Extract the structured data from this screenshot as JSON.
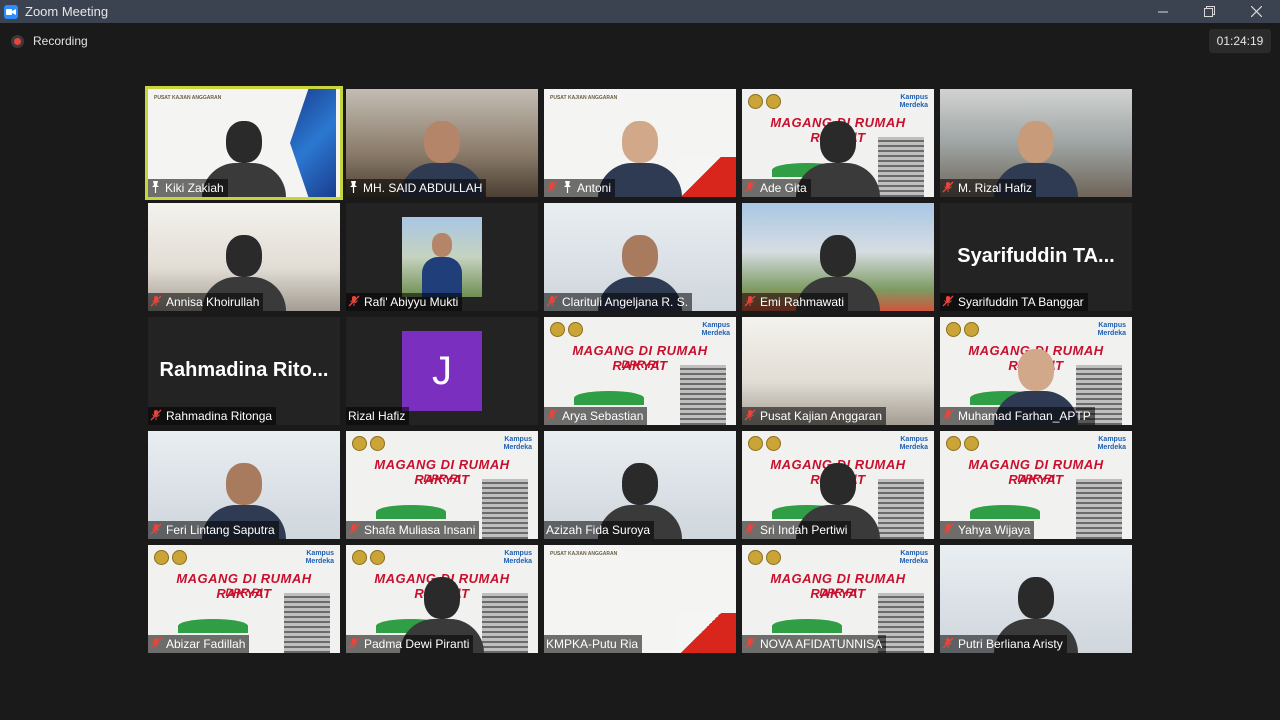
{
  "window": {
    "title": "Zoom Meeting"
  },
  "recording": {
    "label": "Recording"
  },
  "timer": {
    "value": "01:24:19"
  },
  "colors": {
    "active_speaker": "#c7d43a",
    "titlebar": "#3c4350",
    "mic_muted": "#e8453c"
  },
  "participants": [
    {
      "name": "Kiki Zakiah",
      "pinned": true,
      "muted": false,
      "video": "slide-chevron",
      "active": true
    },
    {
      "name": "MH. SAID ABDULLAH",
      "pinned": true,
      "muted": false,
      "video": "room"
    },
    {
      "name": "Antoni",
      "pinned": true,
      "muted": true,
      "video": "slide"
    },
    {
      "name": "Ade Gita",
      "muted": true,
      "video": "banner"
    },
    {
      "name": "M. Rizal Hafiz",
      "muted": true,
      "video": "library"
    },
    {
      "name": "Annisa Khoirullah",
      "muted": true,
      "video": "office"
    },
    {
      "name": "Rafi' Abiyyu Mukti",
      "muted": true,
      "video": "outdoor-small"
    },
    {
      "name": "Clarituli Angeljana R. S.",
      "muted": true,
      "video": "bright"
    },
    {
      "name": "Emi Rahmawati",
      "muted": true,
      "video": "outdoor"
    },
    {
      "name": "Syarifuddin TA Banggar",
      "muted": true,
      "video": "off",
      "display_name": "Syarifuddin TA..."
    },
    {
      "name": "Rahmadina Ritonga",
      "muted": true,
      "video": "off",
      "display_name": "Rahmadina Rito..."
    },
    {
      "name": "Rizal Hafiz",
      "muted": false,
      "video": "avatar",
      "avatar_letter": "J"
    },
    {
      "name": "Arya Sebastian",
      "muted": true,
      "video": "banner"
    },
    {
      "name": "Pusat Kajian Anggaran",
      "muted": true,
      "video": "office"
    },
    {
      "name": "Muhamad Farhan_APTP",
      "muted": true,
      "video": "banner"
    },
    {
      "name": "Feri Lintang Saputra",
      "muted": true,
      "video": "bright"
    },
    {
      "name": "Shafa Muliasa Insani",
      "muted": true,
      "video": "banner"
    },
    {
      "name": "Azizah Fida Suroya",
      "muted": false,
      "video": "bright"
    },
    {
      "name": "Sri Indah Pertiwi",
      "muted": true,
      "video": "banner"
    },
    {
      "name": "Yahya Wijaya",
      "muted": true,
      "video": "banner"
    },
    {
      "name": "Abizar Fadillah",
      "muted": true,
      "video": "banner"
    },
    {
      "name": "Padma Dewi Piranti",
      "muted": true,
      "video": "banner"
    },
    {
      "name": "KMPKA-Putu Ria",
      "muted": false,
      "video": "slide"
    },
    {
      "name": "NOVA AFIDATUNNISA",
      "muted": true,
      "video": "banner"
    },
    {
      "name": "Putri Berliana Aristy",
      "muted": true,
      "video": "bright"
    }
  ],
  "banner": {
    "title": "MAGANG DI RUMAH RAKYAT",
    "subtitle": "DPR RI",
    "logo_line1": "Kampus",
    "logo_line2": "Merdeka"
  },
  "slide": {
    "header": "PUSAT KAJIAN ANGGARAN"
  }
}
